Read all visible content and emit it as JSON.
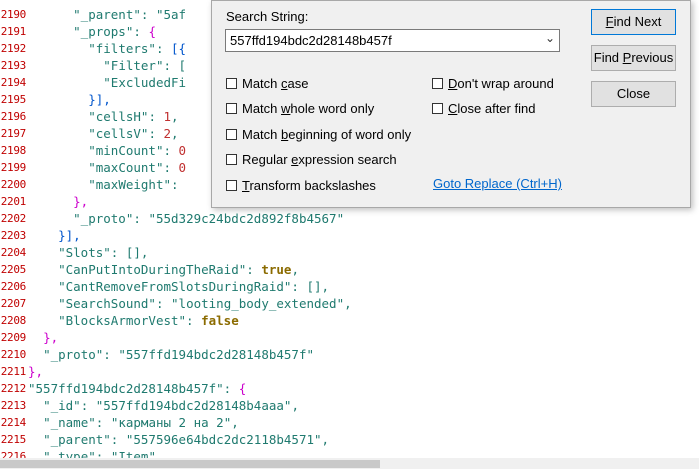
{
  "editor": {
    "line_numbers": [
      "2190",
      "2191",
      "2192",
      "2193",
      "2194",
      "2195",
      "2196",
      "2197",
      "2198",
      "2199",
      "2200",
      "2201",
      "2202",
      "2203",
      "2204",
      "2205",
      "2206",
      "2207",
      "2208",
      "2209",
      "2210",
      "2211",
      "2212",
      "2213",
      "2214",
      "2215",
      "2216"
    ],
    "lines": [
      {
        "indent": "      ",
        "parts": [
          [
            "k",
            "\"_parent\""
          ],
          [
            "p",
            ": "
          ],
          [
            "s",
            "\"5af"
          ]
        ]
      },
      {
        "indent": "      ",
        "parts": [
          [
            "k",
            "\"_props\""
          ],
          [
            "p",
            ": "
          ],
          [
            "br1",
            "{"
          ]
        ]
      },
      {
        "indent": "        ",
        "parts": [
          [
            "k",
            "\"filters\""
          ],
          [
            "p",
            ": "
          ],
          [
            "br2",
            "[{"
          ]
        ]
      },
      {
        "indent": "          ",
        "parts": [
          [
            "k",
            "\"Filter\""
          ],
          [
            "p",
            ": ["
          ]
        ]
      },
      {
        "indent": "          ",
        "parts": [
          [
            "k",
            "\"ExcludedFi"
          ]
        ]
      },
      {
        "indent": "        ",
        "parts": [
          [
            "br2",
            "}],"
          ]
        ]
      },
      {
        "indent": "        ",
        "parts": [
          [
            "k",
            "\"cellsH\""
          ],
          [
            "p",
            ": "
          ],
          [
            "n",
            "1"
          ],
          [
            "p",
            ","
          ]
        ]
      },
      {
        "indent": "        ",
        "parts": [
          [
            "k",
            "\"cellsV\""
          ],
          [
            "p",
            ": "
          ],
          [
            "n",
            "2"
          ],
          [
            "p",
            ","
          ]
        ]
      },
      {
        "indent": "        ",
        "parts": [
          [
            "k",
            "\"minCount\""
          ],
          [
            "p",
            ": "
          ],
          [
            "n",
            "0"
          ]
        ]
      },
      {
        "indent": "        ",
        "parts": [
          [
            "k",
            "\"maxCount\""
          ],
          [
            "p",
            ": "
          ],
          [
            "n",
            "0"
          ]
        ]
      },
      {
        "indent": "        ",
        "parts": [
          [
            "k",
            "\"maxWeight\""
          ],
          [
            "p",
            ": "
          ]
        ]
      },
      {
        "indent": "      ",
        "parts": [
          [
            "br1",
            "},"
          ]
        ]
      },
      {
        "indent": "      ",
        "parts": [
          [
            "k",
            "\"_proto\""
          ],
          [
            "p",
            ": "
          ],
          [
            "s",
            "\"55d329c24bdc2d892f8b4567\""
          ]
        ]
      },
      {
        "indent": "    ",
        "parts": [
          [
            "br2",
            "}],"
          ]
        ]
      },
      {
        "indent": "    ",
        "parts": [
          [
            "k",
            "\"Slots\""
          ],
          [
            "p",
            ": [],"
          ]
        ]
      },
      {
        "indent": "    ",
        "parts": [
          [
            "k",
            "\"CanPutIntoDuringTheRaid\""
          ],
          [
            "p",
            ": "
          ],
          [
            "b",
            "true"
          ],
          [
            "p",
            ","
          ]
        ]
      },
      {
        "indent": "    ",
        "parts": [
          [
            "k",
            "\"CantRemoveFromSlotsDuringRaid\""
          ],
          [
            "p",
            ": [],"
          ]
        ]
      },
      {
        "indent": "    ",
        "parts": [
          [
            "k",
            "\"SearchSound\""
          ],
          [
            "p",
            ": "
          ],
          [
            "s",
            "\"looting_body_extended\""
          ],
          [
            "p",
            ","
          ]
        ]
      },
      {
        "indent": "    ",
        "parts": [
          [
            "k",
            "\"BlocksArmorVest\""
          ],
          [
            "p",
            ": "
          ],
          [
            "b",
            "false"
          ]
        ]
      },
      {
        "indent": "  ",
        "parts": [
          [
            "br1",
            "},"
          ]
        ]
      },
      {
        "indent": "  ",
        "parts": [
          [
            "k",
            "\"_proto\""
          ],
          [
            "p",
            ": "
          ],
          [
            "s",
            "\"557ffd194bdc2d28148b457f\""
          ]
        ]
      },
      {
        "indent": "",
        "parts": [
          [
            "br1",
            "},"
          ]
        ]
      },
      {
        "indent": "",
        "parts": [
          [
            "k",
            "\"557ffd194bdc2d28148b457f\""
          ],
          [
            "p",
            ": "
          ],
          [
            "br1",
            "{"
          ]
        ]
      },
      {
        "indent": "  ",
        "parts": [
          [
            "k",
            "\"_id\""
          ],
          [
            "p",
            ": "
          ],
          [
            "s",
            "\"557ffd194bdc2d28148b4aaa\""
          ],
          [
            "p",
            ","
          ]
        ]
      },
      {
        "indent": "  ",
        "parts": [
          [
            "k",
            "\"_name\""
          ],
          [
            "p",
            ": "
          ],
          [
            "s",
            "\"карманы 2 на 2\""
          ],
          [
            "p",
            ","
          ]
        ]
      },
      {
        "indent": "  ",
        "parts": [
          [
            "k",
            "\"_parent\""
          ],
          [
            "p",
            ": "
          ],
          [
            "s",
            "\"557596e64bdc2dc2118b4571\""
          ],
          [
            "p",
            ","
          ]
        ]
      },
      {
        "indent": "  ",
        "parts": [
          [
            "k",
            "\"_type\""
          ],
          [
            "p",
            ": "
          ],
          [
            "s",
            "\"Item\""
          ],
          [
            "p",
            ","
          ]
        ]
      }
    ]
  },
  "dialog": {
    "search_label": "Search String:",
    "search_value": "557ffd194bdc2d28148b457f",
    "options_left": [
      {
        "pre": "Match ",
        "u": "c",
        "post": "ase"
      },
      {
        "pre": "Match ",
        "u": "w",
        "post": "hole word only"
      },
      {
        "pre": "Match ",
        "u": "b",
        "post": "eginning of word only"
      },
      {
        "pre": "Regular ",
        "u": "e",
        "post": "xpression search"
      },
      {
        "pre": "",
        "u": "T",
        "post": "ransform backslashes"
      }
    ],
    "options_right": [
      {
        "pre": "",
        "u": "D",
        "post": "on't wrap around"
      },
      {
        "pre": "",
        "u": "C",
        "post": "lose after find"
      }
    ],
    "buttons": {
      "find_next": {
        "pre": "",
        "u": "F",
        "post": "ind Next"
      },
      "find_previous": {
        "pre": "Find ",
        "u": "P",
        "post": "revious"
      },
      "close": "Close"
    },
    "goto_replace": "Goto Replace (Ctrl+H)"
  },
  "colors": {
    "key": "#1f7a6f",
    "number": "#c03030",
    "boolean": "#8b6b00",
    "line_number": "#c00000",
    "link": "#0066cc"
  }
}
